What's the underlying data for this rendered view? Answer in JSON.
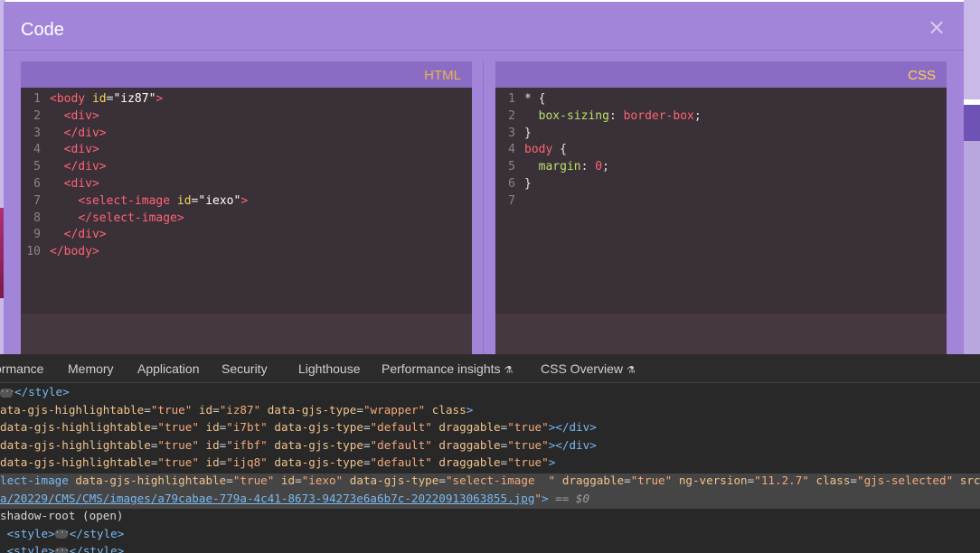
{
  "modal": {
    "title": "Code",
    "close_glyph": "×"
  },
  "html_panel": {
    "label": "HTML",
    "lines": [
      {
        "n": "1",
        "parts": [
          [
            "tag",
            "<body "
          ],
          [
            "attr",
            "id"
          ],
          [
            "plain",
            "="
          ],
          [
            "str",
            "\"iz87\""
          ],
          [
            "tag",
            ">"
          ]
        ]
      },
      {
        "n": "2",
        "parts": [
          [
            "plain",
            "  "
          ],
          [
            "tag",
            "<div>"
          ]
        ]
      },
      {
        "n": "3",
        "parts": [
          [
            "plain",
            "  "
          ],
          [
            "tag",
            "</div>"
          ]
        ]
      },
      {
        "n": "4",
        "parts": [
          [
            "plain",
            "  "
          ],
          [
            "tag",
            "<div>"
          ]
        ]
      },
      {
        "n": "5",
        "parts": [
          [
            "plain",
            "  "
          ],
          [
            "tag",
            "</div>"
          ]
        ]
      },
      {
        "n": "6",
        "parts": [
          [
            "plain",
            "  "
          ],
          [
            "tag",
            "<div>"
          ]
        ]
      },
      {
        "n": "7",
        "parts": [
          [
            "plain",
            "    "
          ],
          [
            "tag",
            "<select-image "
          ],
          [
            "attr",
            "id"
          ],
          [
            "plain",
            "="
          ],
          [
            "str",
            "\"iexo\""
          ],
          [
            "tag",
            ">"
          ]
        ]
      },
      {
        "n": "8",
        "parts": [
          [
            "plain",
            "    "
          ],
          [
            "tag",
            "</select-image>"
          ]
        ]
      },
      {
        "n": "9",
        "parts": [
          [
            "plain",
            "  "
          ],
          [
            "tag",
            "</div>"
          ]
        ]
      },
      {
        "n": "10",
        "parts": [
          [
            "tag",
            "</body>"
          ]
        ]
      }
    ]
  },
  "css_panel": {
    "label": "CSS",
    "lines": [
      {
        "n": "1",
        "parts": [
          [
            "plain",
            "* {"
          ]
        ]
      },
      {
        "n": "2",
        "parts": [
          [
            "plain",
            "  "
          ],
          [
            "prop",
            "box-sizing"
          ],
          [
            "plain",
            ": "
          ],
          [
            "val",
            "border-box"
          ],
          [
            "plain",
            ";"
          ]
        ]
      },
      {
        "n": "3",
        "parts": [
          [
            "plain",
            "}"
          ]
        ]
      },
      {
        "n": "4",
        "parts": [
          [
            "val",
            "body"
          ],
          [
            "plain",
            " {"
          ]
        ]
      },
      {
        "n": "5",
        "parts": [
          [
            "plain",
            "  "
          ],
          [
            "prop",
            "margin"
          ],
          [
            "plain",
            ": "
          ],
          [
            "val",
            "0"
          ],
          [
            "plain",
            ";"
          ]
        ]
      },
      {
        "n": "6",
        "parts": [
          [
            "plain",
            "}"
          ]
        ]
      },
      {
        "n": "7",
        "parts": [
          [
            "plain",
            ""
          ]
        ]
      }
    ]
  },
  "devtools": {
    "tabs": [
      {
        "label": "ormance",
        "flask": false
      },
      {
        "label": "Memory",
        "flask": false
      },
      {
        "label": "Application",
        "flask": false
      },
      {
        "label": "Security",
        "flask": false
      },
      {
        "label": "Lighthouse",
        "flask": false
      },
      {
        "label": "Performance insights",
        "flask": true
      },
      {
        "label": "CSS Overview",
        "flask": true
      }
    ],
    "flask_glyph": "⚗",
    "dom_lines": [
      {
        "sel": false,
        "ellipsis": true,
        "parts": [
          [
            "t",
            "</style>"
          ]
        ]
      },
      {
        "sel": false,
        "ellipsis": false,
        "parts": [
          [
            "a",
            "ata-gjs-highlightable"
          ],
          [
            "p",
            "="
          ],
          [
            "v",
            "\"true\""
          ],
          [
            "p",
            " "
          ],
          [
            "a",
            "id"
          ],
          [
            "p",
            "="
          ],
          [
            "v",
            "\"iz87\""
          ],
          [
            "p",
            " "
          ],
          [
            "a",
            "data-gjs-type"
          ],
          [
            "p",
            "="
          ],
          [
            "v",
            "\"wrapper\""
          ],
          [
            "p",
            " "
          ],
          [
            "a",
            "class"
          ],
          [
            "t",
            ">"
          ]
        ]
      },
      {
        "sel": false,
        "ellipsis": false,
        "parts": [
          [
            "a",
            "data-gjs-highlightable"
          ],
          [
            "p",
            "="
          ],
          [
            "v",
            "\"true\""
          ],
          [
            "p",
            " "
          ],
          [
            "a",
            "id"
          ],
          [
            "p",
            "="
          ],
          [
            "v",
            "\"i7bt\""
          ],
          [
            "p",
            " "
          ],
          [
            "a",
            "data-gjs-type"
          ],
          [
            "p",
            "="
          ],
          [
            "v",
            "\"default\""
          ],
          [
            "p",
            " "
          ],
          [
            "a",
            "draggable"
          ],
          [
            "p",
            "="
          ],
          [
            "v",
            "\"true\""
          ],
          [
            "t",
            "></div>"
          ]
        ]
      },
      {
        "sel": false,
        "ellipsis": false,
        "parts": [
          [
            "a",
            "data-gjs-highlightable"
          ],
          [
            "p",
            "="
          ],
          [
            "v",
            "\"true\""
          ],
          [
            "p",
            " "
          ],
          [
            "a",
            "id"
          ],
          [
            "p",
            "="
          ],
          [
            "v",
            "\"ifbf\""
          ],
          [
            "p",
            " "
          ],
          [
            "a",
            "data-gjs-type"
          ],
          [
            "p",
            "="
          ],
          [
            "v",
            "\"default\""
          ],
          [
            "p",
            " "
          ],
          [
            "a",
            "draggable"
          ],
          [
            "p",
            "="
          ],
          [
            "v",
            "\"true\""
          ],
          [
            "t",
            "></div>"
          ]
        ]
      },
      {
        "sel": false,
        "ellipsis": false,
        "parts": [
          [
            "a",
            "data-gjs-highlightable"
          ],
          [
            "p",
            "="
          ],
          [
            "v",
            "\"true\""
          ],
          [
            "p",
            " "
          ],
          [
            "a",
            "id"
          ],
          [
            "p",
            "="
          ],
          [
            "v",
            "\"ijq8\""
          ],
          [
            "p",
            " "
          ],
          [
            "a",
            "data-gjs-type"
          ],
          [
            "p",
            "="
          ],
          [
            "v",
            "\"default\""
          ],
          [
            "p",
            " "
          ],
          [
            "a",
            "draggable"
          ],
          [
            "p",
            "="
          ],
          [
            "v",
            "\"true\""
          ],
          [
            "t",
            ">"
          ]
        ]
      },
      {
        "sel": true,
        "ellipsis": false,
        "parts": [
          [
            "t",
            "lect-image"
          ],
          [
            "p",
            " "
          ],
          [
            "a",
            "data-gjs-highlightable"
          ],
          [
            "p",
            "="
          ],
          [
            "v",
            "\"true\""
          ],
          [
            "p",
            " "
          ],
          [
            "a",
            "id"
          ],
          [
            "p",
            "="
          ],
          [
            "v",
            "\"iexo\""
          ],
          [
            "p",
            " "
          ],
          [
            "a",
            "data-gjs-type"
          ],
          [
            "p",
            "="
          ],
          [
            "v",
            "\"select-image  \""
          ],
          [
            "p",
            " "
          ],
          [
            "a",
            "draggable"
          ],
          [
            "p",
            "="
          ],
          [
            "v",
            "\"true\""
          ],
          [
            "p",
            " "
          ],
          [
            "a",
            "ng-version"
          ],
          [
            "p",
            "="
          ],
          [
            "v",
            "\"11.2.7\""
          ],
          [
            "p",
            " "
          ],
          [
            "a",
            "class"
          ],
          [
            "p",
            "="
          ],
          [
            "v",
            "\"gjs-selected\""
          ],
          [
            "p",
            " "
          ],
          [
            "a",
            "src"
          ],
          [
            "p",
            "="
          ],
          [
            "link",
            "\"M"
          ]
        ]
      },
      {
        "sel": true,
        "ellipsis": false,
        "parts": [
          [
            "link",
            "a/20229/CMS/CMS/images/a79cabae-779a-4c41-8673-94273e6a6b7c-20220913063855.jpg"
          ],
          [
            "v",
            "\""
          ],
          [
            "t",
            ">"
          ],
          [
            "eq",
            " == $0"
          ]
        ]
      },
      {
        "sel": false,
        "ellipsis": false,
        "parts": [
          [
            "p",
            "shadow-root (open)"
          ]
        ]
      },
      {
        "sel": false,
        "ellipsis": true,
        "parts": [
          [
            "t",
            "<style>"
          ],
          [
            "ellipsis",
            ""
          ],
          [
            "t",
            "</style>"
          ]
        ]
      },
      {
        "sel": false,
        "ellipsis": true,
        "parts": [
          [
            "t",
            "<style>"
          ],
          [
            "ellipsis",
            ""
          ],
          [
            "t",
            "</style>"
          ]
        ]
      }
    ]
  },
  "colors": {
    "modal_bg": "#a285d8",
    "editor_bg": "#3a3038",
    "devtools_bg": "#282828"
  }
}
